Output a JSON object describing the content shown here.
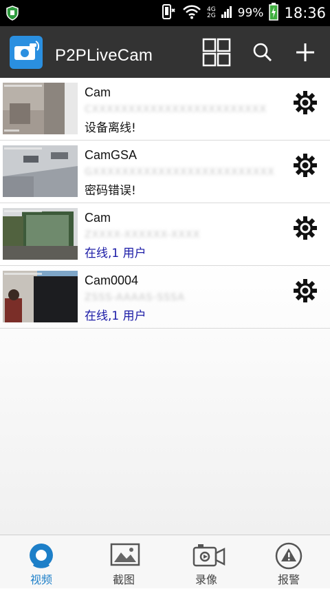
{
  "status_bar": {
    "network_top": "4G",
    "network_bottom": "2G",
    "battery": "99%",
    "time": "18:36"
  },
  "app_bar": {
    "title": "P2PLiveCam",
    "accent": "#2a8fe0"
  },
  "cameras": [
    {
      "name": "Cam",
      "uid": "CXXXXXXXXXXXXXXXXXXXXXXXX",
      "status": "设备离线!",
      "online": false
    },
    {
      "name": "CamGSA",
      "uid": "GXXXXXXXXXXXXXXXXXXXXXXXXX",
      "status": "密码错误!",
      "online": false
    },
    {
      "name": "Cam",
      "uid": "ZXXXX-XXXXXX-XXXX",
      "status": "在线,1 用户",
      "online": true
    },
    {
      "name": "Cam0004",
      "uid": "ZSSS-AAAAS-SSSA",
      "status": "在线,1 用户",
      "online": true
    }
  ],
  "bottom_nav": [
    {
      "label": "视频",
      "icon": "video-icon",
      "active": true
    },
    {
      "label": "截图",
      "icon": "picture-icon",
      "active": false
    },
    {
      "label": "录像",
      "icon": "video-camera-icon",
      "active": false
    },
    {
      "label": "报警",
      "icon": "alarm-icon",
      "active": false
    }
  ],
  "colors": {
    "status_online": "#1a1aa6",
    "nav_active": "#1d7fc8"
  }
}
